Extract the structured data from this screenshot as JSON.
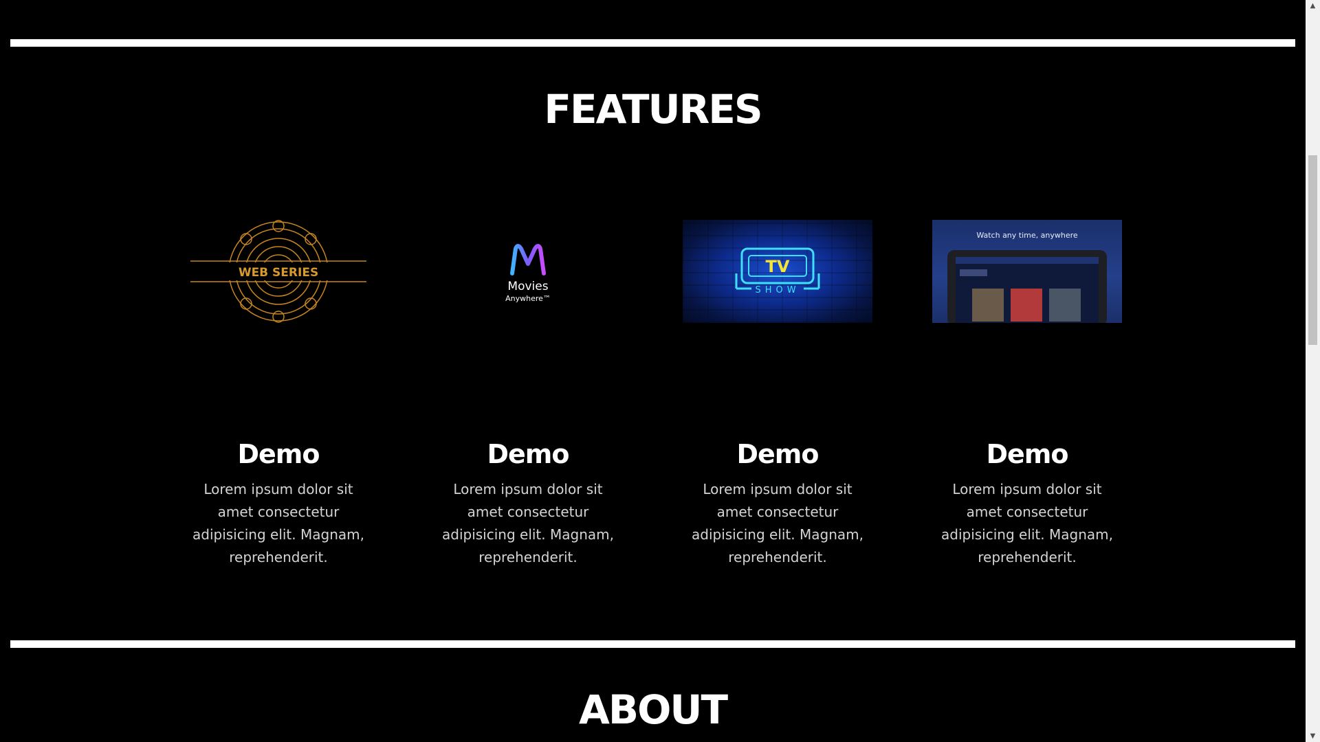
{
  "sections": {
    "features_title": "FEATURES",
    "about_title": "ABOUT"
  },
  "features": [
    {
      "image_label": "WEB SERIES",
      "icon": "web-series-logo",
      "title": "Demo",
      "text": "Lorem ipsum dolor sit amet consectetur adipisicing elit. Magnam, reprehenderit."
    },
    {
      "image_label": "Movies",
      "image_sublabel": "Anywhere™",
      "icon": "movies-anywhere-logo",
      "title": "Demo",
      "text": "Lorem ipsum dolor sit amet consectetur adipisicing elit. Magnam, reprehenderit."
    },
    {
      "image_label": "TV",
      "image_sublabel": "SHOW",
      "icon": "tv-show-neon-sign",
      "title": "Demo",
      "text": "Lorem ipsum dolor sit amet consectetur adipisicing elit. Magnam, reprehenderit."
    },
    {
      "image_label": "Watch any time, anywhere",
      "icon": "tablet-streaming-app",
      "title": "Demo",
      "text": "Lorem ipsum dolor sit amet consectetur adipisicing elit. Magnam, reprehenderit."
    }
  ],
  "colors": {
    "background": "#000000",
    "divider": "#ffffff",
    "gold": "#c8861e",
    "neon_cyan": "#3fe0ff",
    "neon_yellow": "#f2e43a"
  }
}
